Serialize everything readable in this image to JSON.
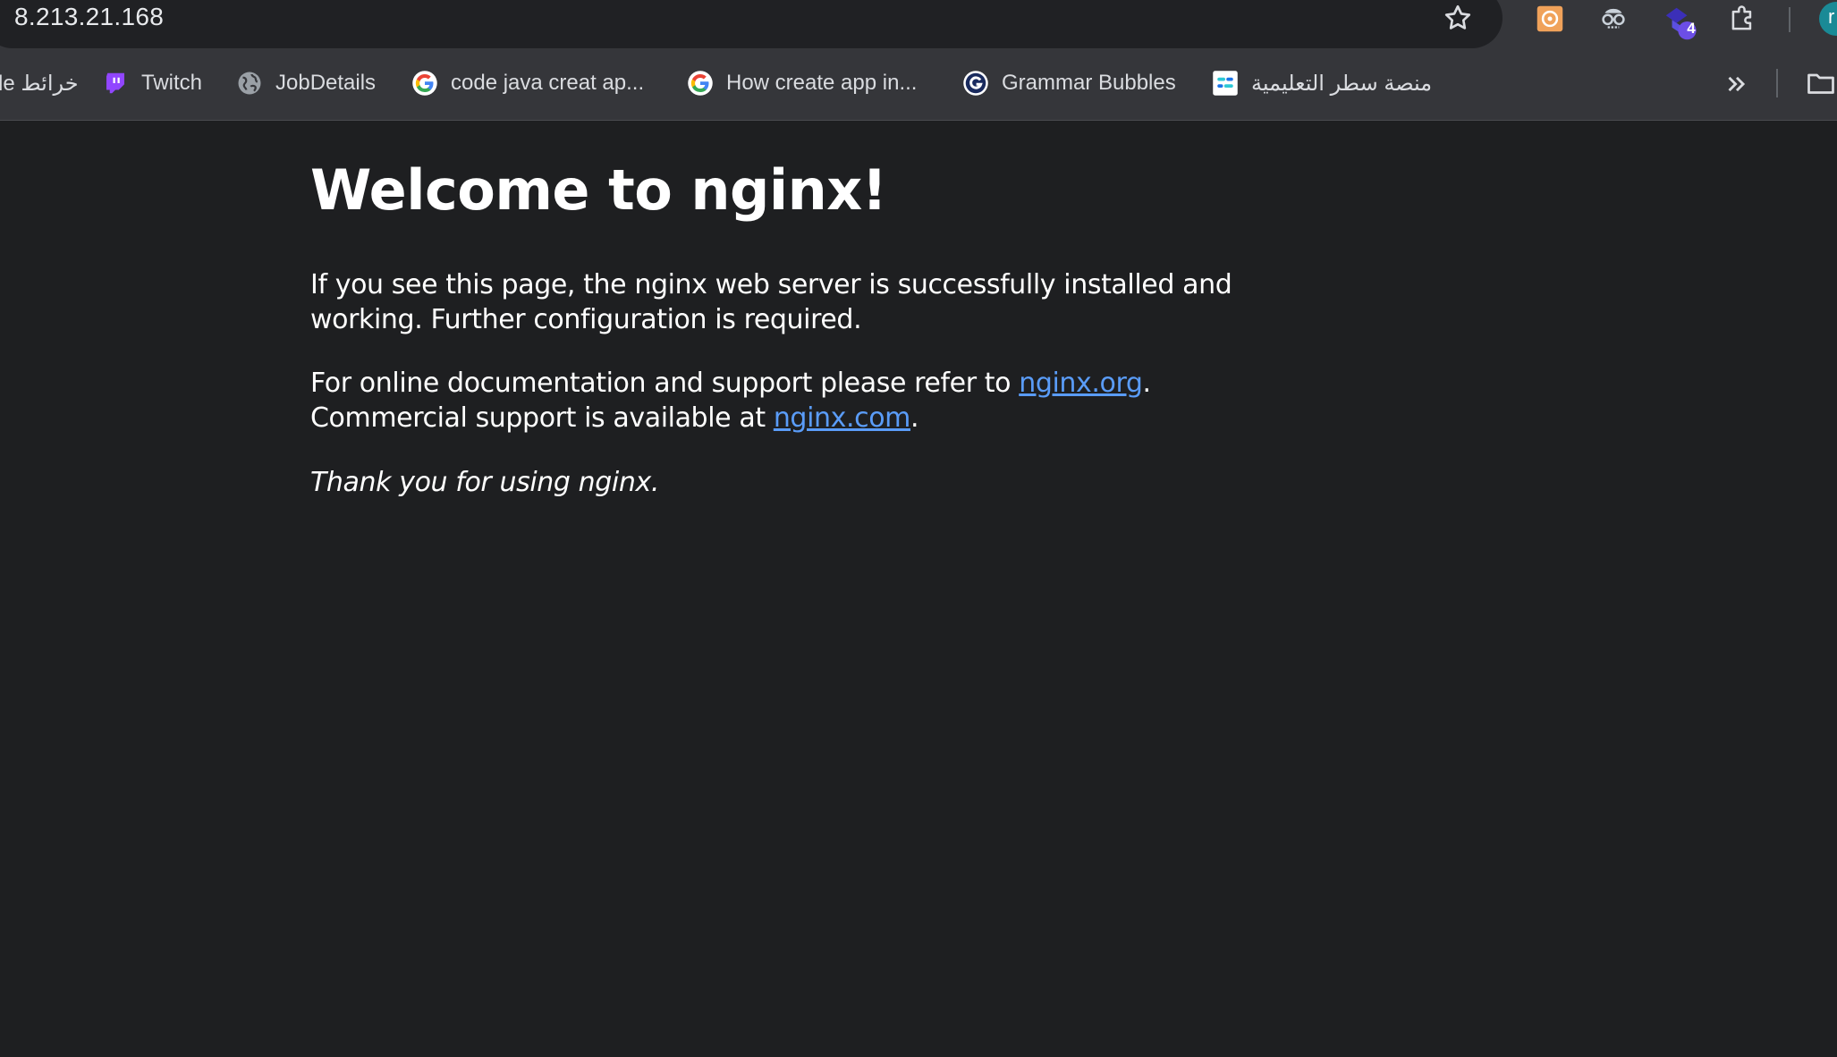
{
  "browser": {
    "url": "8.213.21.168",
    "extensions_badge": "4",
    "profile_initial": "r"
  },
  "bookmarks": [
    {
      "label": "le خرائط",
      "icon": "maps-icon"
    },
    {
      "label": "Twitch",
      "icon": "twitch-icon"
    },
    {
      "label": "JobDetails",
      "icon": "globe-icon"
    },
    {
      "label": "code java creat ap...",
      "icon": "google-icon"
    },
    {
      "label": "How create app in...",
      "icon": "google-icon"
    },
    {
      "label": "Grammar Bubbles",
      "icon": "grammar-icon"
    },
    {
      "label": "منصة سطر التعليمية",
      "icon": "satr-icon"
    }
  ],
  "page": {
    "title": "Welcome to nginx!",
    "p1_line1": "If you see this page, the nginx web server is successfully installed and",
    "p1_line2": "working. Further configuration is required.",
    "p2_text1": "For online documentation and support please refer to ",
    "p2_link1": "nginx.org",
    "p2_text2": ".",
    "p2_text3": "Commercial support is available at ",
    "p2_link2": "nginx.com",
    "p2_text4": ".",
    "p3": "Thank you for using nginx."
  },
  "colors": {
    "page_bg": "#1e1f21",
    "toolbar_bg": "#35363a",
    "link": "#5a9cf8"
  }
}
